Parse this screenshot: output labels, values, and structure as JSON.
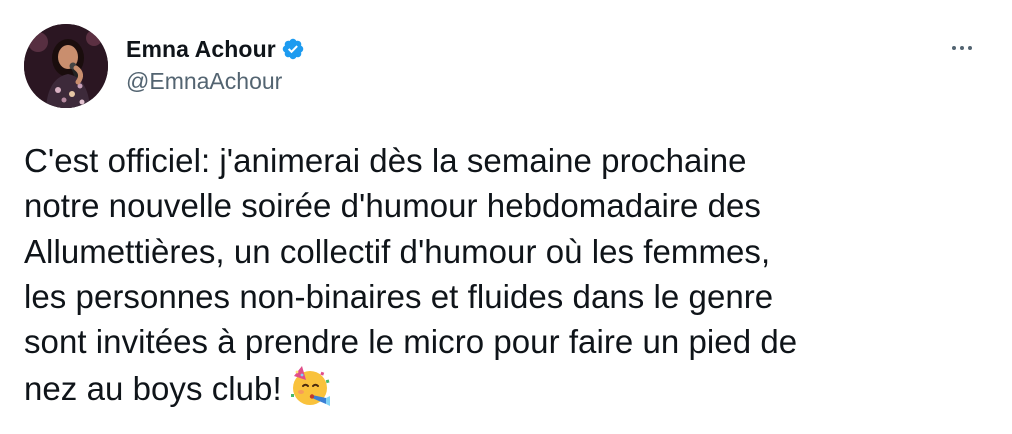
{
  "author": {
    "display_name": "Emna Achour",
    "handle": "@EmnaAchour",
    "verified": true,
    "verified_icon": "verified-badge-icon",
    "verified_color": "#1d9bf0"
  },
  "menu": {
    "icon": "more-horizontal-icon"
  },
  "tweet": {
    "lines": [
      "C'est officiel: j'animerai dès la semaine prochaine",
      "notre nouvelle soirée d'humour hebdomadaire des",
      "Allumettières, un collectif d'humour où les femmes,",
      "les personnes non-binaires et fluides dans le genre",
      "sont invitées à prendre le micro pour faire un pied de",
      "nez au boys club!"
    ],
    "emoji": "partying-face-emoji"
  },
  "colors": {
    "text_primary": "#0f1419",
    "text_secondary": "#536471",
    "accent": "#1d9bf0"
  }
}
